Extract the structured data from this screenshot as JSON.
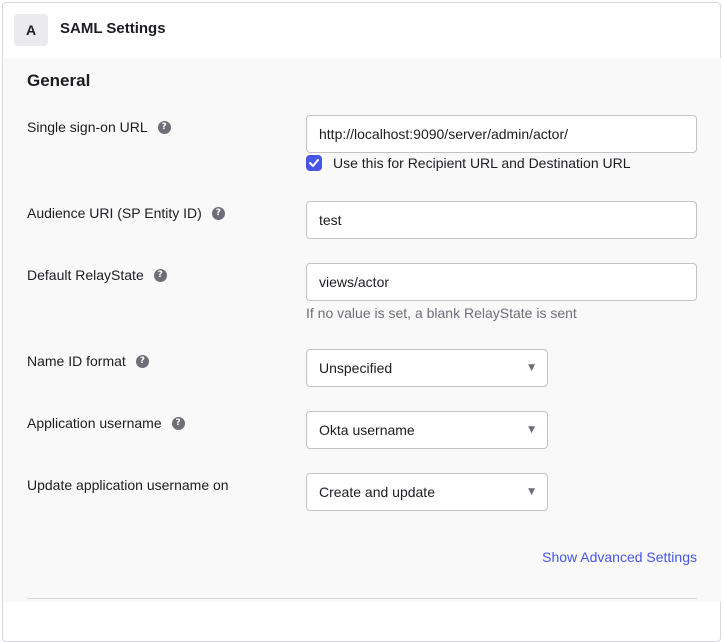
{
  "panel": {
    "step": "A",
    "title": "SAML Settings"
  },
  "section": {
    "heading": "General"
  },
  "fields": {
    "sso_url": {
      "label": "Single sign-on URL",
      "value": "http://localhost:9090/server/admin/actor/",
      "checkbox_label": "Use this for Recipient URL and Destination URL",
      "checkbox_checked": true
    },
    "audience_uri": {
      "label": "Audience URI (SP Entity ID)",
      "value": "test"
    },
    "relay_state": {
      "label": "Default RelayState",
      "value": "views/actor",
      "hint": "If no value is set, a blank RelayState is sent"
    },
    "name_id_format": {
      "label": "Name ID format",
      "selected": "Unspecified"
    },
    "app_username": {
      "label": "Application username",
      "selected": "Okta username"
    },
    "update_username_on": {
      "label": "Update application username on",
      "selected": "Create and update"
    }
  },
  "links": {
    "advanced": "Show Advanced Settings"
  },
  "colors": {
    "accent": "#4756e6",
    "help_icon": "#6e6e78",
    "border": "#c1c1c8"
  },
  "icons": {
    "help": "help-icon",
    "checkbox": "checkmark-icon",
    "dropdown": "chevron-down-icon"
  }
}
